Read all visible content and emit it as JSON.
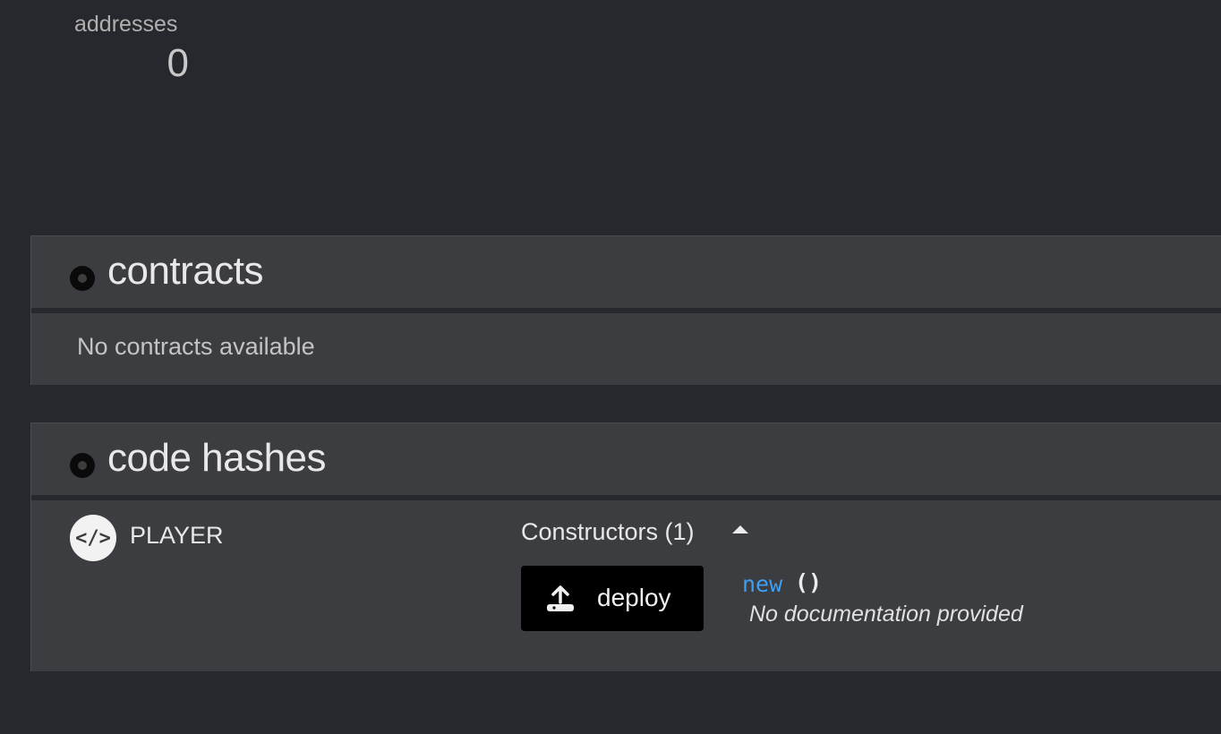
{
  "stats": {
    "addresses_label": "addresses",
    "addresses_value": "0"
  },
  "contracts": {
    "title": "contracts",
    "empty_text": "No contracts available"
  },
  "code_hashes": {
    "title": "code hashes",
    "items": [
      {
        "name": "PLAYER",
        "icon": "code-icon",
        "constructors_label": "Constructors (1)",
        "deploy_label": "deploy",
        "method_name": "new",
        "method_parens": "()",
        "method_doc": "No documentation provided"
      }
    ]
  },
  "colors": {
    "background": "#27282d",
    "panel": "#3c3d40",
    "accent_blue": "#3e9ef2",
    "button": "#000000"
  }
}
